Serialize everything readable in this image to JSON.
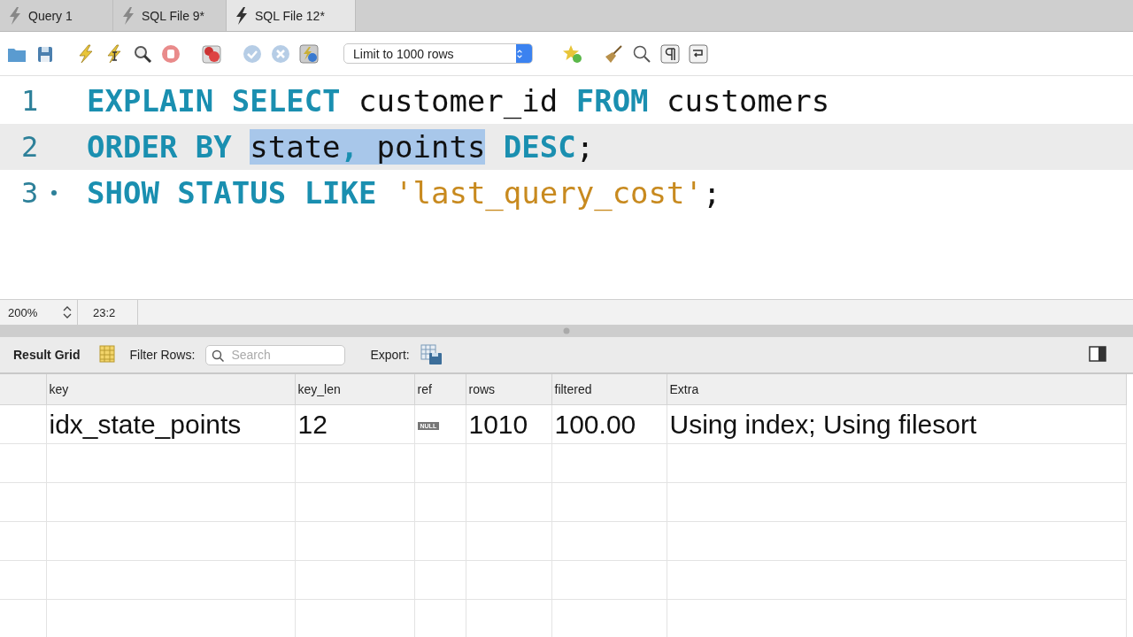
{
  "tabs": [
    {
      "label": "Query 1",
      "selected": false
    },
    {
      "label": "SQL File 9*",
      "selected": false
    },
    {
      "label": "SQL File 12*",
      "selected": true
    }
  ],
  "toolbar": {
    "limit_select": "Limit to 1000 rows"
  },
  "editor": {
    "lines": [
      {
        "number": "1",
        "current": false,
        "statement_marker": false,
        "tokens": [
          {
            "text": "EXPLAIN SELECT ",
            "kind": "keyword",
            "selected": false
          },
          {
            "text": "customer_id ",
            "kind": "ident",
            "selected": false
          },
          {
            "text": "FROM ",
            "kind": "keyword",
            "selected": false
          },
          {
            "text": "customers",
            "kind": "ident",
            "selected": false
          }
        ]
      },
      {
        "number": "2",
        "current": true,
        "statement_marker": false,
        "tokens": [
          {
            "text": "ORDER BY ",
            "kind": "keyword",
            "selected": false
          },
          {
            "text": "state",
            "kind": "ident",
            "selected": true
          },
          {
            "text": ",",
            "kind": "comma",
            "selected": true
          },
          {
            "text": " points",
            "kind": "ident",
            "selected": true
          },
          {
            "text": " DESC",
            "kind": "keyword",
            "selected": false
          },
          {
            "text": ";",
            "kind": "punct",
            "selected": false
          }
        ]
      },
      {
        "number": "3",
        "current": false,
        "statement_marker": true,
        "tokens": [
          {
            "text": "SHOW STATUS LIKE ",
            "kind": "keyword",
            "selected": false
          },
          {
            "text": "'last_query_cost'",
            "kind": "string",
            "selected": false
          },
          {
            "text": ";",
            "kind": "punct",
            "selected": false
          }
        ]
      }
    ]
  },
  "status_bar": {
    "zoom": "200%",
    "position": "23:2"
  },
  "results": {
    "title": "Result Grid",
    "filter_label": "Filter Rows:",
    "search_placeholder": "Search",
    "export_label": "Export:",
    "columns": [
      "key",
      "key_len",
      "ref",
      "rows",
      "filtered",
      "Extra"
    ],
    "rows": [
      [
        {
          "text": "idx_state_points",
          "kind": "text"
        },
        {
          "text": "12",
          "kind": "text"
        },
        {
          "text": "NULL",
          "kind": "null"
        },
        {
          "text": "1010",
          "kind": "text"
        },
        {
          "text": "100.00",
          "kind": "text"
        },
        {
          "text": "Using index; Using filesort",
          "kind": "text"
        }
      ]
    ]
  }
}
